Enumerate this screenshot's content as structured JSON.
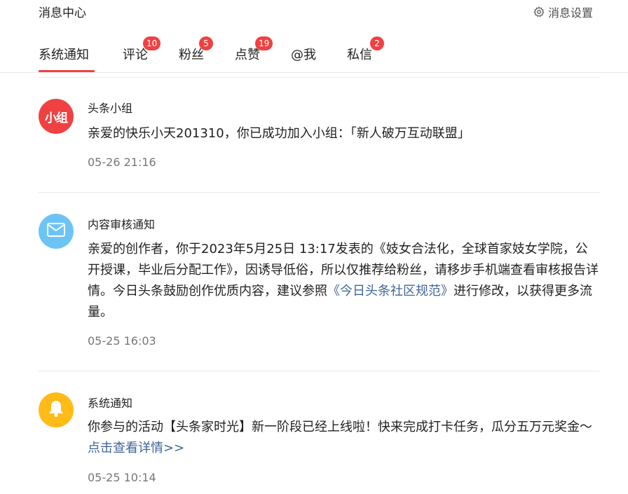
{
  "header": {
    "title": "消息中心",
    "settings_label": "消息设置",
    "settings_icon": "gear-icon"
  },
  "tabs": [
    {
      "label": "系统通知",
      "badge": null,
      "active": true
    },
    {
      "label": "评论",
      "badge": "10",
      "active": false
    },
    {
      "label": "粉丝",
      "badge": "5",
      "active": false
    },
    {
      "label": "点赞",
      "badge": "19",
      "active": false
    },
    {
      "label": "@我",
      "badge": null,
      "active": false
    },
    {
      "label": "私信",
      "badge": "2",
      "active": false
    }
  ],
  "messages": [
    {
      "sender": "头条小组",
      "avatar_text": "小组",
      "avatar_color": "#f04142",
      "body": "亲爱的快乐小天201310，你已成功加入小组：「新人破万互动联盟」",
      "time": "05-26 21:16"
    },
    {
      "sender": "内容审核通知",
      "avatar_icon": "mail-icon",
      "avatar_color": "#6cc4f5",
      "body_pre": "亲爱的创作者，你于2023年5月25日 13:17发表的《妓女合法化，全球首家妓女学院，公开授课，毕业后分配工作》，因诱导低俗，所以仅推荐给粉丝，请移步手机端查看审核报告详情。今日头条鼓励创作优质内容，建议参照",
      "body_link": "《今日头条社区规范》",
      "body_post": "进行修改，以获得更多流量。",
      "time": "05-25 16:03"
    },
    {
      "sender": "系统通知",
      "avatar_icon": "bell-icon",
      "avatar_color": "#ffbb17",
      "body_pre": "你参与的活动【头条家时光】新一阶段已经上线啦！快来完成打卡任务，瓜分五万元奖金～",
      "body_link": "点击查看详情>>",
      "time": "05-25 10:14"
    }
  ],
  "colors": {
    "accent": "#f04142",
    "link": "#406599",
    "timestamp": "#777777"
  }
}
